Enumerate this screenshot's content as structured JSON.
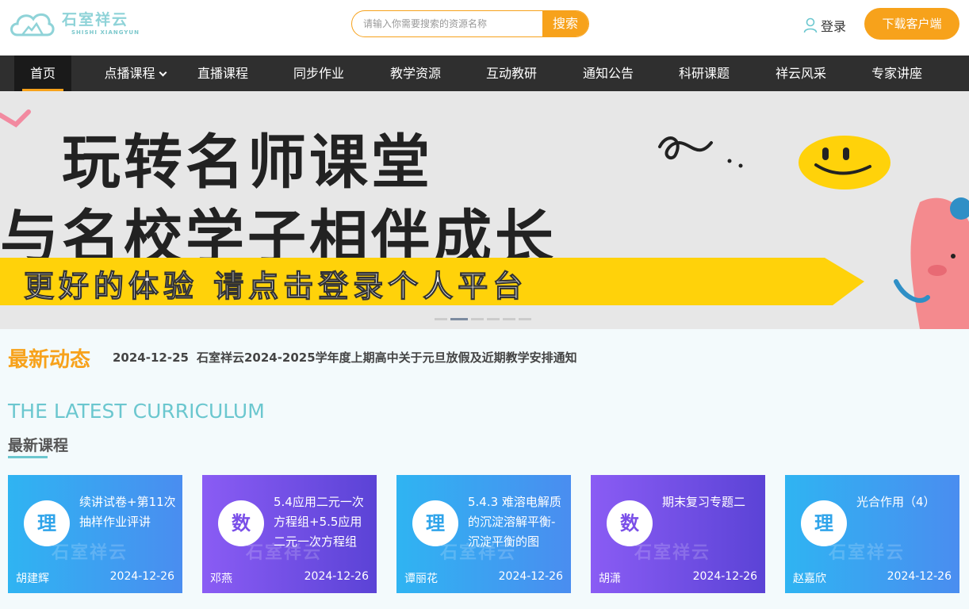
{
  "header": {
    "logo_cn": "石室祥云",
    "logo_en": "SHISHI XIANGYUN",
    "search_placeholder": "请输入你需要搜索的资源名称",
    "search_button": "搜索",
    "login": "登录",
    "download": "下载客户端"
  },
  "nav": {
    "items": [
      {
        "label": "首页"
      },
      {
        "label": "点播课程"
      },
      {
        "label": "直播课程"
      },
      {
        "label": "同步作业"
      },
      {
        "label": "教学资源"
      },
      {
        "label": "互动教研"
      },
      {
        "label": "通知公告"
      },
      {
        "label": "科研课题"
      },
      {
        "label": "祥云风采"
      },
      {
        "label": "专家讲座"
      }
    ]
  },
  "banner": {
    "line1": "玩转名师课堂",
    "line2": "与名校学子相伴成长",
    "line3": "更好的体验 请点击登录个人平台",
    "slide_count": 6,
    "active_slide": 2
  },
  "news": {
    "title": "最新动态",
    "date": "2024-12-25",
    "text": "石室祥云2024-2025学年度上期高中关于元旦放假及近期教学安排通知"
  },
  "section": {
    "title_en": "THE LATEST CURRICULUM",
    "title_cn": "最新课程"
  },
  "courses": [
    {
      "badge": "理",
      "title": "续讲试卷+第11次抽样作业评讲",
      "author": "胡建辉",
      "date": "2024-12-26",
      "color": "blue"
    },
    {
      "badge": "数",
      "title": "5.4应用二元一次方程组+5.5应用二元一次方程组",
      "author": "邓燕",
      "date": "2024-12-26",
      "color": "purple"
    },
    {
      "badge": "理",
      "title": "5.4.3 难溶电解质的沉淀溶解平衡-沉淀平衡的图",
      "author": "谭丽花",
      "date": "2024-12-26",
      "color": "blue"
    },
    {
      "badge": "数",
      "title": "期末复习专题二",
      "author": "胡潇",
      "date": "2024-12-26",
      "color": "purple"
    },
    {
      "badge": "理",
      "title": "光合作用（4）",
      "author": "赵嘉欣",
      "date": "2024-12-26",
      "color": "blue"
    }
  ],
  "colors": {
    "accent": "#f7a21b",
    "nav_bg": "#2f2f2f",
    "teal": "#6bc7cf",
    "card_blue": "#2fb4f2",
    "card_purple": "#8a5cf4"
  }
}
